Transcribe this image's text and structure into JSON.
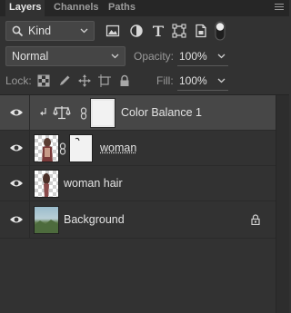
{
  "tabs": [
    {
      "label": "Layers",
      "active": true
    },
    {
      "label": "Channels",
      "active": false
    },
    {
      "label": "Paths",
      "active": false
    }
  ],
  "filter": {
    "kind_label": "Kind",
    "icons": [
      "image-filter-icon",
      "adjustment-filter-icon",
      "type-filter-icon",
      "shape-filter-icon",
      "smart-object-filter-icon",
      "filter-toggle-icon"
    ]
  },
  "blend": {
    "mode": "Normal",
    "opacity_label": "Opacity:",
    "opacity_value": "100%",
    "fill_label": "Fill:",
    "fill_value": "100%"
  },
  "lock": {
    "label": "Lock:",
    "icons": [
      "lock-transparent-pixels-icon",
      "lock-image-pixels-icon",
      "lock-position-icon",
      "lock-artboard-icon",
      "lock-all-icon"
    ]
  },
  "layers": [
    {
      "name": "Color Balance 1",
      "type": "adjustment",
      "visible": true,
      "selected": true,
      "clipped": true
    },
    {
      "name": "woman",
      "type": "masked-image",
      "visible": true,
      "selected": false
    },
    {
      "name": "woman hair",
      "type": "image",
      "visible": true,
      "selected": false
    },
    {
      "name": "Background",
      "type": "background",
      "visible": true,
      "selected": false,
      "locked": true
    }
  ],
  "colors": {
    "panel_bg": "#323232",
    "selected_row": "#474747",
    "tabbar_bg": "#262626"
  }
}
